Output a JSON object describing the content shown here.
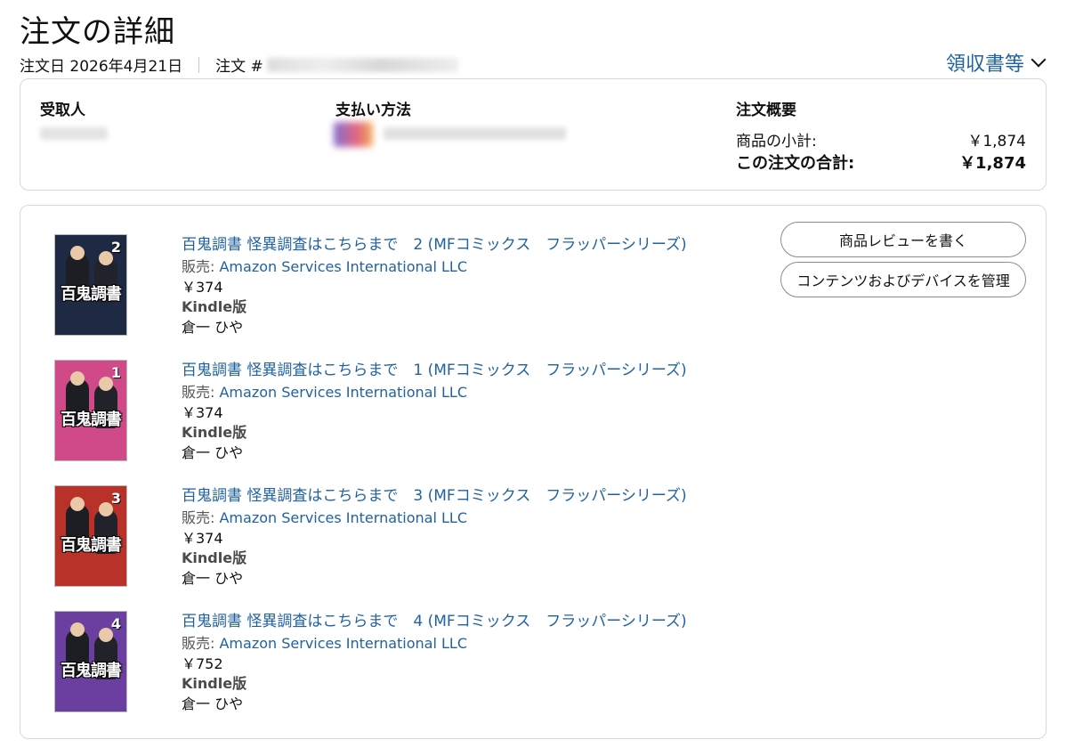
{
  "header": {
    "title": "注文の詳細",
    "order_date_label": "注文日 2026年4月21日",
    "order_number_label": "注文 #",
    "receipt_link": "領収書等"
  },
  "summary": {
    "recipient_label": "受取人",
    "payment_label": "支払い方法",
    "overview_label": "注文概要",
    "subtotal_label": "商品の小計:",
    "subtotal_value": "￥1,874",
    "total_label": "この注文の合計:",
    "total_value": "￥1,874"
  },
  "actions": {
    "review_button": "商品レビューを書く",
    "manage_button": "コンテンツおよびデバイスを管理"
  },
  "items": [
    {
      "title": "百鬼調書 怪異調査はこちらまで　2 (MFコミックス　フラッパーシリーズ)",
      "seller_prefix": "販売: ",
      "seller": "Amazon Services International LLC",
      "price": "￥374",
      "format": "Kindle版",
      "author": "倉一 ひや",
      "cover_title": "百鬼調書",
      "cover_vol": "2",
      "cover_color": "#1e2a44"
    },
    {
      "title": "百鬼調書 怪異調査はこちらまで　1 (MFコミックス　フラッパーシリーズ)",
      "seller_prefix": "販売: ",
      "seller": "Amazon Services International LLC",
      "price": "￥374",
      "format": "Kindle版",
      "author": "倉一 ひや",
      "cover_title": "百鬼調書",
      "cover_vol": "1",
      "cover_color": "#d04a8a"
    },
    {
      "title": "百鬼調書 怪異調査はこちらまで　3 (MFコミックス　フラッパーシリーズ)",
      "seller_prefix": "販売: ",
      "seller": "Amazon Services International LLC",
      "price": "￥374",
      "format": "Kindle版",
      "author": "倉一 ひや",
      "cover_title": "百鬼調書",
      "cover_vol": "3",
      "cover_color": "#b8322a"
    },
    {
      "title": "百鬼調書 怪異調査はこちらまで　4 (MFコミックス　フラッパーシリーズ)",
      "seller_prefix": "販売: ",
      "seller": "Amazon Services International LLC",
      "price": "￥752",
      "format": "Kindle版",
      "author": "倉一 ひや",
      "cover_title": "百鬼調書",
      "cover_vol": "4",
      "cover_color": "#6a3fa0"
    }
  ]
}
